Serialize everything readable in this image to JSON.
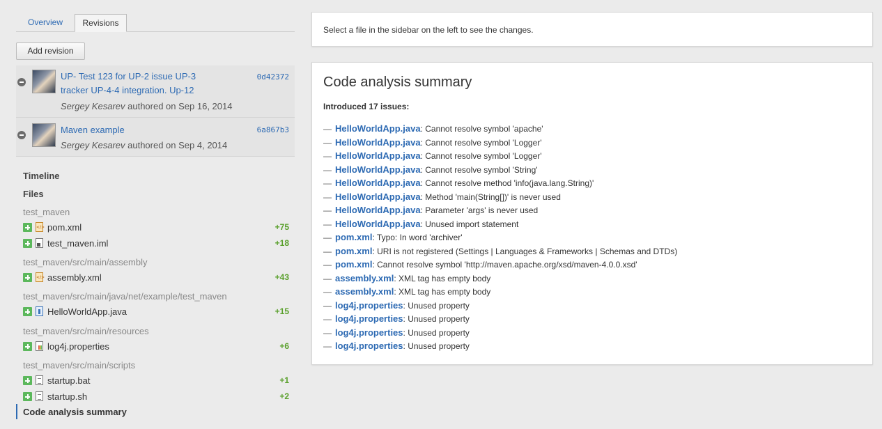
{
  "tabs": {
    "overview": "Overview",
    "revisions": "Revisions"
  },
  "add_revision_label": "Add revision",
  "revisions": [
    {
      "title": "UP- Test 123 for UP-2 issue UP-3 tracker UP-4-4 integration. Up-12",
      "hash": "0d42372",
      "author": "Sergey Kesarev",
      "authored": "authored on Sep 16, 2014"
    },
    {
      "title": "Maven example",
      "hash": "6a867b3",
      "author": "Sergey Kesarev",
      "authored": "authored on Sep 4, 2014"
    }
  ],
  "sections": {
    "timeline": "Timeline",
    "files": "Files",
    "code_analysis": "Code analysis summary"
  },
  "file_groups": [
    {
      "path": "test_maven",
      "files": [
        {
          "name": "pom.xml",
          "icon": "xml-file-icon",
          "count": "+75"
        },
        {
          "name": "test_maven.iml",
          "icon": "iml-file-icon",
          "count": "+18"
        }
      ]
    },
    {
      "path": "test_maven/src/main/assembly",
      "files": [
        {
          "name": "assembly.xml",
          "icon": "xml-file-icon",
          "count": "+43"
        }
      ]
    },
    {
      "path": "test_maven/src/main/java/net/example/test_maven",
      "files": [
        {
          "name": "HelloWorldApp.java",
          "icon": "java-file-icon",
          "count": "+15"
        }
      ]
    },
    {
      "path": "test_maven/src/main/resources",
      "files": [
        {
          "name": "log4j.properties",
          "icon": "properties-file-icon",
          "count": "+6"
        }
      ]
    },
    {
      "path": "test_maven/src/main/scripts",
      "files": [
        {
          "name": "startup.bat",
          "icon": "text-file-icon",
          "count": "+1"
        },
        {
          "name": "startup.sh",
          "icon": "text-file-icon",
          "count": "+2"
        }
      ]
    }
  ],
  "select_hint": "Select a file in the sidebar on the left to see the changes.",
  "summary": {
    "title": "Code analysis summary",
    "intro": "Introduced 17 issues:",
    "issues": [
      {
        "file": "HelloWorldApp.java",
        "msg": ": Cannot resolve symbol 'apache'"
      },
      {
        "file": "HelloWorldApp.java",
        "msg": ": Cannot resolve symbol 'Logger'"
      },
      {
        "file": "HelloWorldApp.java",
        "msg": ": Cannot resolve symbol 'Logger'"
      },
      {
        "file": "HelloWorldApp.java",
        "msg": ": Cannot resolve symbol 'String'"
      },
      {
        "file": "HelloWorldApp.java",
        "msg": ": Cannot resolve method 'info(java.lang.String)'"
      },
      {
        "file": "HelloWorldApp.java",
        "msg": ": Method 'main(String[])' is never used"
      },
      {
        "file": "HelloWorldApp.java",
        "msg": ": Parameter 'args' is never used"
      },
      {
        "file": "HelloWorldApp.java",
        "msg": ": Unused import statement"
      },
      {
        "file": "pom.xml",
        "msg": ": Typo: In word 'archiver'"
      },
      {
        "file": "pom.xml",
        "msg": ": URI is not registered (Settings | Languages & Frameworks | Schemas and DTDs)"
      },
      {
        "file": "pom.xml",
        "msg": ": Cannot resolve symbol 'http://maven.apache.org/xsd/maven-4.0.0.xsd'"
      },
      {
        "file": "assembly.xml",
        "msg": ": XML tag has empty body"
      },
      {
        "file": "assembly.xml",
        "msg": ": XML tag has empty body"
      },
      {
        "file": "log4j.properties",
        "msg": ": Unused property"
      },
      {
        "file": "log4j.properties",
        "msg": ": Unused property"
      },
      {
        "file": "log4j.properties",
        "msg": ": Unused property"
      },
      {
        "file": "log4j.properties",
        "msg": ": Unused property"
      }
    ]
  }
}
